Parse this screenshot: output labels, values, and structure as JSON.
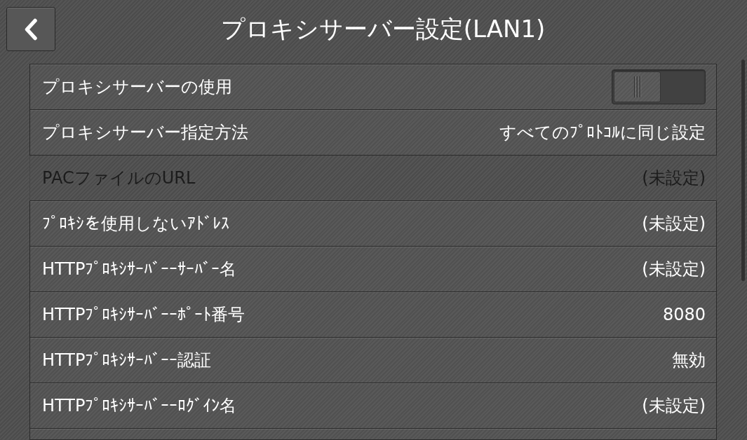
{
  "header": {
    "title": "プロキシサーバー設定(LAN1)"
  },
  "settings": [
    {
      "kind": "toggle",
      "label": "プロキシサーバーの使用",
      "on": false,
      "disabled": false
    },
    {
      "kind": "value",
      "label": "プロキシサーバー指定方法",
      "value": "すべてのﾌﾟﾛﾄｺﾙに同じ設定",
      "disabled": false
    },
    {
      "kind": "value",
      "label": "PACファイルのURL",
      "value": "(未設定)",
      "disabled": true
    },
    {
      "kind": "value",
      "label": "ﾌﾟﾛｷｼを使用しないｱﾄﾞﾚｽ",
      "value": "(未設定)",
      "disabled": false
    },
    {
      "kind": "value",
      "label": "HTTPﾌﾟﾛｷｼｻｰﾊﾞｰｰｻｰﾊﾞｰ名",
      "value": "(未設定)",
      "disabled": false
    },
    {
      "kind": "value",
      "label": "HTTPﾌﾟﾛｷｼｻｰﾊﾞｰｰﾎﾟｰﾄ番号",
      "value": "8080",
      "disabled": false
    },
    {
      "kind": "value",
      "label": "HTTPﾌﾟﾛｷｼｻｰﾊﾞｰｰ認証",
      "value": "無効",
      "disabled": false
    },
    {
      "kind": "value",
      "label": "HTTPﾌﾟﾛｷｼｻｰﾊﾞｰｰﾛｸﾞｲﾝ名",
      "value": "(未設定)",
      "disabled": false
    }
  ]
}
